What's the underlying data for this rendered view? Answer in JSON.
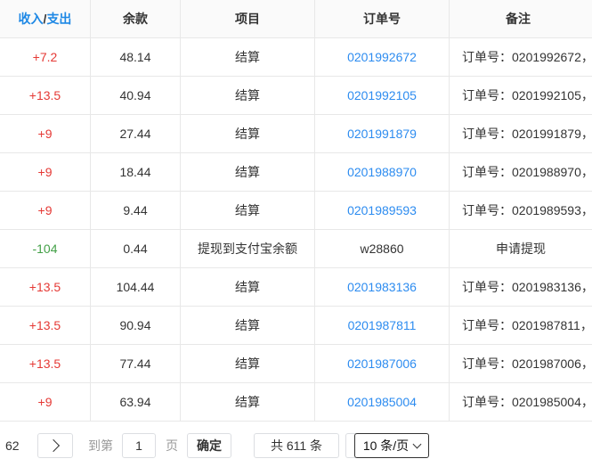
{
  "header": {
    "income": "收入",
    "slash": "/",
    "expense": "支出",
    "balance": "余款",
    "item": "项目",
    "order_no": "订单号",
    "remark": "备注"
  },
  "rows": [
    {
      "amount": "+7.2",
      "balance": "48.14",
      "item": "结算",
      "order": "0201992672",
      "remark": "订单号：0201992672，",
      "type": "pos"
    },
    {
      "amount": "+13.5",
      "balance": "40.94",
      "item": "结算",
      "order": "0201992105",
      "remark": "订单号：0201992105，",
      "type": "pos"
    },
    {
      "amount": "+9",
      "balance": "27.44",
      "item": "结算",
      "order": "0201991879",
      "remark": "订单号：0201991879，",
      "type": "pos"
    },
    {
      "amount": "+9",
      "balance": "18.44",
      "item": "结算",
      "order": "0201988970",
      "remark": "订单号：0201988970，",
      "type": "pos"
    },
    {
      "amount": "+9",
      "balance": "9.44",
      "item": "结算",
      "order": "0201989593",
      "remark": "订单号：0201989593，",
      "type": "pos"
    },
    {
      "amount": "-104",
      "balance": "0.44",
      "item": "提现到支付宝余额",
      "order": "w28860",
      "remark": "申请提现",
      "type": "neg"
    },
    {
      "amount": "+13.5",
      "balance": "104.44",
      "item": "结算",
      "order": "0201983136",
      "remark": "订单号：0201983136，",
      "type": "pos"
    },
    {
      "amount": "+13.5",
      "balance": "90.94",
      "item": "结算",
      "order": "0201987811",
      "remark": "订单号：0201987811，",
      "type": "pos"
    },
    {
      "amount": "+13.5",
      "balance": "77.44",
      "item": "结算",
      "order": "0201987006",
      "remark": "订单号：0201987006，",
      "type": "pos"
    },
    {
      "amount": "+9",
      "balance": "63.94",
      "item": "结算",
      "order": "0201985004",
      "remark": "订单号：0201985004，",
      "type": "pos"
    }
  ],
  "pagination": {
    "last_page": "62",
    "goto_label": "到第",
    "page_input": "1",
    "page_unit": "页",
    "confirm": "确定",
    "total": "共 611 条",
    "page_size": "10 条/页"
  },
  "colors": {
    "income": "#e53935",
    "expense": "#43a047",
    "link": "#2d8cf0",
    "header_accent": "#1e88e5"
  }
}
